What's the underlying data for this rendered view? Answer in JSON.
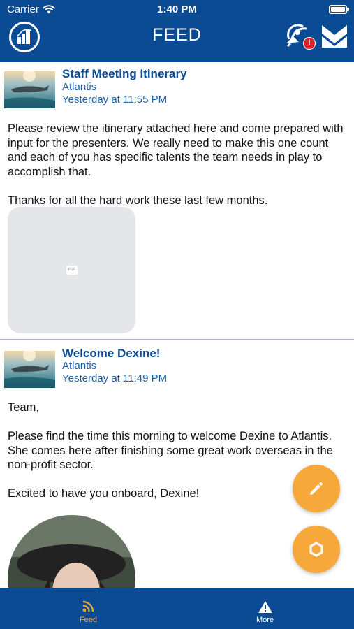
{
  "status_bar": {
    "carrier": "Carrier",
    "time": "1:40 PM"
  },
  "header": {
    "title": "FEED",
    "badge": "!"
  },
  "posts": [
    {
      "title": "Staff Meeting Itinerary",
      "group": "Atlantis",
      "timestamp": "Yesterday at 11:55 PM",
      "paragraphs": [
        "Please review the itinerary attached here and come prepared with input for the presenters. We really need to make this one count and each of you has specific talents the team needs in play to accomplish that.",
        "Thanks for all the hard work these last few months."
      ],
      "attachment_label": "PDF"
    },
    {
      "title": "Welcome Dexine!",
      "group": "Atlantis",
      "timestamp": "Yesterday at 11:49 PM",
      "paragraphs": [
        "Team,",
        "Please find the time this morning to welcome Dexine to Atlantis. She comes here after finishing some great work overseas in the non-profit sector.",
        "Excited to have you onboard, Dexine!"
      ]
    }
  ],
  "fabs": [
    {
      "icon": "pencil-icon"
    },
    {
      "icon": "hexagon-icon"
    }
  ],
  "tabbar": {
    "items": [
      {
        "label": "Feed",
        "icon": "rss-icon",
        "active": true
      },
      {
        "label": "More",
        "icon": "warning-icon",
        "active": false
      }
    ]
  },
  "colors": {
    "brand": "#0a4b94",
    "accent": "#f7a83a",
    "active_tab": "#e9a93d",
    "badge": "#d8232a",
    "link": "#1b5ea8"
  }
}
